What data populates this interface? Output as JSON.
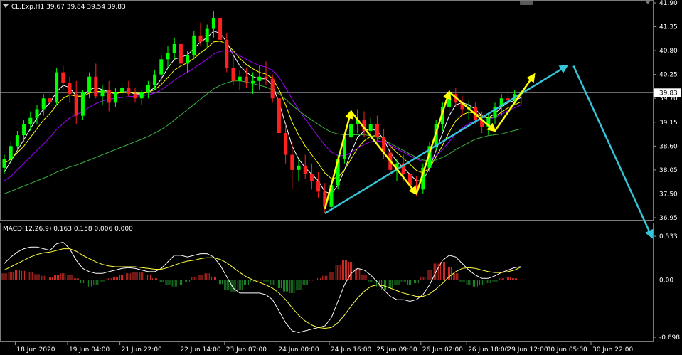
{
  "chart_data": {
    "type": "candlestick",
    "symbol_header": "CL.Exp,H1  39.67 39.84 39.54 39.83",
    "price_panel": {
      "ylim": [
        36.95,
        41.9
      ],
      "y_ticks": [
        "41.90",
        "41.35",
        "40.80",
        "40.25",
        "39.70",
        "39.15",
        "38.60",
        "38.05",
        "37.50",
        "36.95"
      ],
      "current_price_label": "39.83",
      "current_price": 39.83,
      "candles": [
        [
          38.1,
          38.4,
          37.95,
          38.3
        ],
        [
          38.3,
          38.7,
          38.2,
          38.6
        ],
        [
          38.6,
          38.95,
          38.5,
          38.85
        ],
        [
          38.85,
          39.2,
          38.7,
          39.1
        ],
        [
          39.1,
          39.4,
          38.95,
          39.25
        ],
        [
          39.25,
          39.55,
          39.1,
          39.45
        ],
        [
          39.45,
          39.8,
          39.3,
          39.7
        ],
        [
          39.7,
          39.9,
          39.5,
          39.6
        ],
        [
          39.6,
          40.4,
          39.55,
          40.3
        ],
        [
          40.3,
          40.45,
          39.9,
          40.05
        ],
        [
          40.05,
          40.2,
          39.6,
          39.8
        ],
        [
          39.8,
          40.1,
          39.1,
          39.3
        ],
        [
          39.3,
          39.9,
          39.2,
          39.85
        ],
        [
          39.85,
          40.3,
          39.7,
          40.2
        ],
        [
          40.2,
          40.5,
          39.7,
          39.75
        ],
        [
          39.75,
          40.0,
          39.55,
          39.9
        ],
        [
          39.9,
          40.1,
          39.4,
          39.6
        ],
        [
          39.6,
          39.95,
          39.5,
          39.85
        ],
        [
          39.85,
          40.05,
          39.65,
          39.95
        ],
        [
          39.95,
          40.1,
          39.75,
          39.8
        ],
        [
          39.8,
          39.95,
          39.6,
          39.7
        ],
        [
          39.7,
          39.9,
          39.55,
          39.85
        ],
        [
          39.85,
          40.1,
          39.7,
          40.0
        ],
        [
          40.0,
          40.35,
          39.9,
          40.25
        ],
        [
          40.25,
          40.7,
          40.1,
          40.6
        ],
        [
          40.6,
          40.9,
          40.4,
          40.75
        ],
        [
          40.75,
          41.1,
          40.6,
          40.95
        ],
        [
          40.95,
          41.05,
          40.4,
          40.5
        ],
        [
          40.5,
          40.8,
          40.3,
          40.7
        ],
        [
          40.7,
          41.25,
          40.6,
          41.15
        ],
        [
          41.15,
          41.45,
          40.9,
          41.0
        ],
        [
          41.0,
          41.4,
          40.85,
          41.3
        ],
        [
          41.3,
          41.7,
          41.1,
          41.55
        ],
        [
          41.55,
          41.6,
          40.9,
          41.05
        ],
        [
          41.05,
          41.2,
          40.3,
          40.4
        ],
        [
          40.4,
          40.7,
          40.0,
          40.1
        ],
        [
          40.1,
          40.35,
          39.9,
          40.2
        ],
        [
          40.2,
          40.4,
          39.95,
          40.05
        ],
        [
          40.05,
          40.3,
          39.8,
          40.1
        ],
        [
          40.1,
          40.45,
          39.9,
          40.2
        ],
        [
          40.2,
          40.55,
          40.0,
          40.15
        ],
        [
          40.15,
          40.25,
          39.6,
          39.7
        ],
        [
          39.7,
          39.85,
          38.7,
          38.9
        ],
        [
          38.9,
          39.1,
          38.2,
          38.4
        ],
        [
          38.4,
          38.7,
          37.6,
          38.05
        ],
        [
          38.05,
          38.3,
          37.8,
          38.15
        ],
        [
          38.15,
          38.4,
          37.85,
          37.95
        ],
        [
          37.95,
          38.2,
          37.6,
          37.8
        ],
        [
          37.8,
          38.0,
          37.4,
          37.55
        ],
        [
          37.55,
          37.75,
          37.05,
          37.2
        ],
        [
          37.2,
          37.8,
          37.1,
          37.7
        ],
        [
          37.7,
          38.4,
          37.6,
          38.3
        ],
        [
          38.3,
          38.9,
          38.2,
          38.8
        ],
        [
          38.8,
          39.2,
          38.7,
          39.1
        ],
        [
          39.1,
          39.45,
          38.9,
          39.2
        ],
        [
          39.2,
          39.4,
          38.8,
          38.95
        ],
        [
          38.95,
          39.25,
          38.8,
          39.1
        ],
        [
          39.1,
          39.3,
          38.7,
          38.8
        ],
        [
          38.8,
          39.0,
          38.3,
          38.45
        ],
        [
          38.45,
          38.6,
          37.9,
          38.05
        ],
        [
          38.05,
          38.3,
          37.8,
          38.2
        ],
        [
          38.2,
          38.4,
          37.8,
          37.95
        ],
        [
          37.95,
          38.1,
          37.6,
          37.7
        ],
        [
          37.7,
          37.9,
          37.45,
          37.6
        ],
        [
          37.6,
          38.2,
          37.5,
          38.1
        ],
        [
          38.1,
          38.7,
          38.0,
          38.6
        ],
        [
          38.6,
          39.2,
          38.5,
          39.1
        ],
        [
          39.1,
          39.6,
          38.95,
          39.5
        ],
        [
          39.5,
          39.9,
          39.3,
          39.8
        ],
        [
          39.8,
          39.95,
          39.5,
          39.6
        ],
        [
          39.6,
          39.75,
          39.3,
          39.45
        ],
        [
          39.45,
          39.65,
          39.2,
          39.5
        ],
        [
          39.5,
          39.6,
          39.1,
          39.2
        ],
        [
          39.2,
          39.4,
          38.9,
          39.05
        ],
        [
          39.05,
          39.35,
          38.85,
          39.25
        ],
        [
          39.25,
          39.6,
          39.1,
          39.5
        ],
        [
          39.5,
          39.8,
          39.3,
          39.7
        ],
        [
          39.7,
          39.95,
          39.5,
          39.65
        ],
        [
          39.65,
          39.9,
          39.55,
          39.8
        ],
        [
          39.8,
          39.9,
          39.54,
          39.83
        ]
      ],
      "moving_averages": [
        {
          "color": "#ffffff",
          "values": [
            38.0,
            38.25,
            38.5,
            38.75,
            39.0,
            39.25,
            39.45,
            39.6,
            39.85,
            40.0,
            39.95,
            39.75,
            39.75,
            39.9,
            39.95,
            39.9,
            39.85,
            39.8,
            39.85,
            39.85,
            39.8,
            39.8,
            39.85,
            39.95,
            40.15,
            40.4,
            40.6,
            40.65,
            40.7,
            40.85,
            41.0,
            41.1,
            41.25,
            41.2,
            41.0,
            40.7,
            40.45,
            40.3,
            40.2,
            40.15,
            40.15,
            40.0,
            39.6,
            39.1,
            38.6,
            38.3,
            38.1,
            37.95,
            37.8,
            37.55,
            37.5,
            37.7,
            38.05,
            38.45,
            38.8,
            38.95,
            39.0,
            38.95,
            38.75,
            38.45,
            38.25,
            38.1,
            37.95,
            37.8,
            37.8,
            38.1,
            38.5,
            38.9,
            39.3,
            39.55,
            39.6,
            39.55,
            39.45,
            39.3,
            39.25,
            39.35,
            39.5,
            39.6,
            39.65,
            39.72
          ]
        },
        {
          "color": "#ffff00",
          "values": [
            38.2,
            38.3,
            38.45,
            38.6,
            38.8,
            39.0,
            39.2,
            39.35,
            39.55,
            39.7,
            39.78,
            39.75,
            39.75,
            39.82,
            39.86,
            39.86,
            39.84,
            39.82,
            39.83,
            39.84,
            39.82,
            39.82,
            39.84,
            39.9,
            40.02,
            40.18,
            40.35,
            40.45,
            40.52,
            40.62,
            40.75,
            40.86,
            41.0,
            41.02,
            40.95,
            40.8,
            40.62,
            40.48,
            40.38,
            40.3,
            40.26,
            40.16,
            39.9,
            39.55,
            39.15,
            38.85,
            38.6,
            38.4,
            38.2,
            37.98,
            37.85,
            37.88,
            38.05,
            38.3,
            38.55,
            38.72,
            38.82,
            38.85,
            38.78,
            38.6,
            38.45,
            38.32,
            38.18,
            38.04,
            37.98,
            38.1,
            38.35,
            38.62,
            38.92,
            39.18,
            39.32,
            39.38,
            39.36,
            39.28,
            39.24,
            39.28,
            39.38,
            39.48,
            39.55,
            39.62
          ]
        },
        {
          "color": "#a000ff",
          "values": [
            37.8,
            37.9,
            38.05,
            38.2,
            38.35,
            38.5,
            38.65,
            38.8,
            38.98,
            39.12,
            39.25,
            39.32,
            39.4,
            39.5,
            39.58,
            39.64,
            39.68,
            39.7,
            39.72,
            39.74,
            39.75,
            39.76,
            39.78,
            39.82,
            39.9,
            40.0,
            40.12,
            40.22,
            40.3,
            40.4,
            40.5,
            40.6,
            40.72,
            40.78,
            40.8,
            40.76,
            40.68,
            40.6,
            40.52,
            40.46,
            40.42,
            40.34,
            40.18,
            39.95,
            39.68,
            39.44,
            39.22,
            39.02,
            38.82,
            38.62,
            38.46,
            38.38,
            38.38,
            38.45,
            38.55,
            38.64,
            38.7,
            38.72,
            38.7,
            38.62,
            38.54,
            38.46,
            38.38,
            38.3,
            38.25,
            38.28,
            38.38,
            38.52,
            38.7,
            38.88,
            39.02,
            39.12,
            39.18,
            39.2,
            39.22,
            39.26,
            39.34,
            39.42,
            39.48,
            39.55
          ]
        },
        {
          "color": "#3cb040",
          "values": [
            37.5,
            37.56,
            37.62,
            37.68,
            37.74,
            37.8,
            37.86,
            37.92,
            38.0,
            38.06,
            38.12,
            38.16,
            38.22,
            38.28,
            38.34,
            38.4,
            38.46,
            38.52,
            38.58,
            38.64,
            38.7,
            38.76,
            38.82,
            38.9,
            38.98,
            39.08,
            39.2,
            39.32,
            39.44,
            39.56,
            39.68,
            39.8,
            39.92,
            40.0,
            40.06,
            40.1,
            40.1,
            40.08,
            40.04,
            40.0,
            39.96,
            39.9,
            39.8,
            39.68,
            39.54,
            39.42,
            39.3,
            39.2,
            39.1,
            39.0,
            38.92,
            38.88,
            38.86,
            38.86,
            38.86,
            38.86,
            38.84,
            38.8,
            38.74,
            38.66,
            38.58,
            38.5,
            38.42,
            38.34,
            38.28,
            38.26,
            38.28,
            38.34,
            38.42,
            38.52,
            38.6,
            38.68,
            38.76,
            38.8,
            38.84,
            38.86,
            38.88,
            38.92,
            38.96,
            39.0
          ]
        }
      ],
      "zigzag_arrows": [
        {
          "from": [
            49,
            37.15
          ],
          "to": [
            53,
            39.4
          ]
        },
        {
          "from": [
            53,
            39.4
          ],
          "to": [
            63,
            37.5
          ]
        },
        {
          "from": [
            63,
            37.5
          ],
          "to": [
            68,
            39.85
          ]
        },
        {
          "from": [
            68,
            39.85
          ],
          "to": [
            75,
            38.95
          ]
        },
        {
          "from": [
            75,
            38.95
          ],
          "to": [
            81,
            40.25
          ]
        }
      ],
      "trend_line": {
        "from": [
          49,
          37.05
        ],
        "to": [
          86,
          40.45
        ]
      },
      "forecast_arrow": {
        "from": [
          87,
          40.45
        ],
        "to": [
          99,
          36.5
        ]
      }
    },
    "macd_panel": {
      "label": "MACD(12,26,9) 0.163 0.158 0.006 0.000",
      "ylim": [
        -0.698,
        0.533
      ],
      "y_ticks": [
        "0.533",
        "0.00",
        "-0.698"
      ],
      "histogram": [
        0.08,
        0.1,
        0.12,
        0.11,
        0.09,
        0.07,
        0.05,
        0.03,
        0.06,
        0.08,
        0.06,
        0.02,
        -0.04,
        -0.08,
        -0.06,
        -0.02,
        0.02,
        0.04,
        0.06,
        0.08,
        0.1,
        0.09,
        0.06,
        0.02,
        -0.03,
        -0.06,
        -0.08,
        -0.06,
        -0.02,
        0.03,
        0.06,
        0.08,
        0.04,
        -0.05,
        -0.12,
        -0.15,
        -0.12,
        -0.06,
        -0.02,
        0.0,
        -0.02,
        -0.06,
        -0.1,
        -0.14,
        -0.16,
        -0.12,
        -0.06,
        0.0,
        0.02,
        0.05,
        0.1,
        0.18,
        0.24,
        0.22,
        0.14,
        0.06,
        -0.02,
        -0.08,
        -0.12,
        -0.1,
        -0.06,
        -0.02,
        -0.06,
        -0.04,
        0.04,
        0.12,
        0.2,
        0.22,
        0.16,
        0.08,
        -0.02,
        -0.06,
        -0.08,
        -0.06,
        -0.04,
        -0.02,
        0.02,
        0.03,
        0.02,
        0.006
      ],
      "macd_line": [
        0.2,
        0.28,
        0.34,
        0.38,
        0.4,
        0.4,
        0.38,
        0.36,
        0.44,
        0.46,
        0.38,
        0.24,
        0.14,
        0.1,
        0.08,
        0.08,
        0.1,
        0.12,
        0.14,
        0.15,
        0.14,
        0.12,
        0.1,
        0.1,
        0.14,
        0.22,
        0.3,
        0.3,
        0.28,
        0.3,
        0.32,
        0.32,
        0.28,
        0.18,
        0.04,
        -0.1,
        -0.16,
        -0.16,
        -0.16,
        -0.16,
        -0.18,
        -0.24,
        -0.38,
        -0.52,
        -0.62,
        -0.64,
        -0.62,
        -0.6,
        -0.58,
        -0.56,
        -0.46,
        -0.26,
        -0.06,
        0.08,
        0.14,
        0.12,
        0.06,
        -0.02,
        -0.12,
        -0.2,
        -0.24,
        -0.24,
        -0.26,
        -0.24,
        -0.18,
        -0.06,
        0.1,
        0.24,
        0.3,
        0.28,
        0.2,
        0.12,
        0.06,
        0.02,
        0.02,
        0.05,
        0.09,
        0.12,
        0.15,
        0.163
      ],
      "signal_line": [
        0.12,
        0.16,
        0.2,
        0.24,
        0.28,
        0.31,
        0.33,
        0.34,
        0.36,
        0.38,
        0.38,
        0.35,
        0.3,
        0.26,
        0.22,
        0.19,
        0.17,
        0.16,
        0.16,
        0.16,
        0.16,
        0.15,
        0.14,
        0.13,
        0.13,
        0.15,
        0.18,
        0.21,
        0.23,
        0.24,
        0.26,
        0.27,
        0.27,
        0.25,
        0.21,
        0.15,
        0.09,
        0.04,
        0.0,
        -0.03,
        -0.06,
        -0.1,
        -0.16,
        -0.24,
        -0.34,
        -0.43,
        -0.5,
        -0.55,
        -0.58,
        -0.59,
        -0.58,
        -0.52,
        -0.43,
        -0.32,
        -0.22,
        -0.14,
        -0.08,
        -0.06,
        -0.07,
        -0.1,
        -0.13,
        -0.16,
        -0.18,
        -0.2,
        -0.2,
        -0.17,
        -0.11,
        -0.04,
        0.04,
        0.1,
        0.14,
        0.15,
        0.14,
        0.12,
        0.1,
        0.09,
        0.09,
        0.1,
        0.12,
        0.158
      ]
    },
    "x_tick_labels": [
      {
        "i": 2,
        "label": "18 Jun 2020"
      },
      {
        "i": 10,
        "label": "19 Jun 04:00"
      },
      {
        "i": 18,
        "label": "21 Jun 22:00"
      },
      {
        "i": 27,
        "label": "22 Jun 14:00"
      },
      {
        "i": 34,
        "label": "23 Jun 07:00"
      },
      {
        "i": 42,
        "label": "24 Jun 00:00"
      },
      {
        "i": 50,
        "label": "24 Jun 16:00"
      },
      {
        "i": 57,
        "label": "25 Jun 09:00"
      },
      {
        "i": 64,
        "label": "26 Jun 02:00"
      },
      {
        "i": 71,
        "label": "26 Jun 18:00"
      },
      {
        "i": 77,
        "label": "29 Jun 12:00"
      },
      {
        "i": 83,
        "label": "30 Jun 05:00"
      },
      {
        "i": 90,
        "label": "30 Jun 22:00"
      }
    ],
    "colors": {
      "background": "#000000",
      "bull": "#00ff00",
      "bear": "#ff2020",
      "grid": "#646464",
      "hist_pos": "#e0302a",
      "hist_neg": "#1f8f2a",
      "zigzag": "#ffff00",
      "trend": "#35c4d8",
      "price_line": "#8c8c8c",
      "price_label_bg": "#ffffff"
    }
  }
}
